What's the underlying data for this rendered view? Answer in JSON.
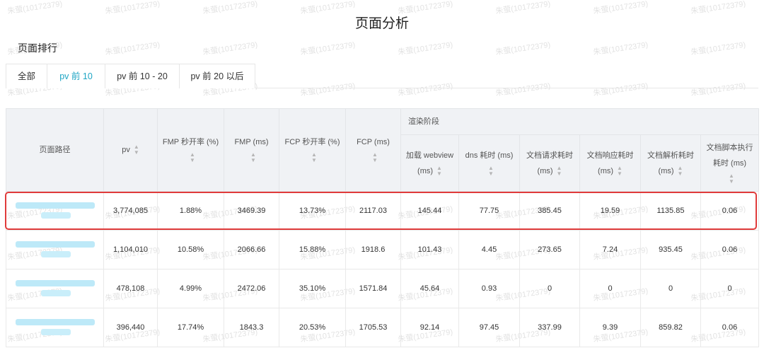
{
  "page_title": "页面分析",
  "section_title": "页面排行",
  "watermark_text": "朱萤(10172379)",
  "tabs": [
    {
      "label": "全部"
    },
    {
      "label": "pv 前 10"
    },
    {
      "label": "pv 前 10 - 20"
    },
    {
      "label": "pv 前 20 以后"
    }
  ],
  "active_tab": "pv 前 10",
  "accent_color": "#1ea5c4",
  "highlight_color": "#e03b3b",
  "columns": {
    "path": "页面路径",
    "pv": "pv",
    "fmp_rate": "FMP 秒开率 (%)",
    "fmp": "FMP (ms)",
    "fcp_rate": "FCP 秒开率 (%)",
    "fcp": "FCP (ms)",
    "render_group": "渲染阶段",
    "webview": "加载 webview (ms)",
    "dns": "dns 耗时 (ms)",
    "doc_request": "文档请求耗时 (ms)",
    "doc_response": "文档响应耗时 (ms)",
    "doc_parse": "文档解析耗时 (ms)",
    "doc_script": "文档脚本执行耗时 (ms)"
  },
  "rows": [
    {
      "pv": "3,774,085",
      "fmp_rate": "1.88%",
      "fmp": "3469.39",
      "fcp_rate": "13.73%",
      "fcp": "2117.03",
      "webview": "145.44",
      "dns": "77.75",
      "doc_request": "385.45",
      "doc_response": "19.59",
      "doc_parse": "1135.85",
      "doc_script": "0.06"
    },
    {
      "pv": "1,104,010",
      "fmp_rate": "10.58%",
      "fmp": "2066.66",
      "fcp_rate": "15.88%",
      "fcp": "1918.6",
      "webview": "101.43",
      "dns": "4.45",
      "doc_request": "273.65",
      "doc_response": "7.24",
      "doc_parse": "935.45",
      "doc_script": "0.06"
    },
    {
      "pv": "478,108",
      "fmp_rate": "4.99%",
      "fmp": "2472.06",
      "fcp_rate": "35.10%",
      "fcp": "1571.84",
      "webview": "45.64",
      "dns": "0.93",
      "doc_request": "0",
      "doc_response": "0",
      "doc_parse": "0",
      "doc_script": "0"
    },
    {
      "pv": "396,440",
      "fmp_rate": "17.74%",
      "fmp": "1843.3",
      "fcp_rate": "20.53%",
      "fcp": "1705.53",
      "webview": "92.14",
      "dns": "97.45",
      "doc_request": "337.99",
      "doc_response": "9.39",
      "doc_parse": "859.82",
      "doc_script": "0.06"
    }
  ]
}
